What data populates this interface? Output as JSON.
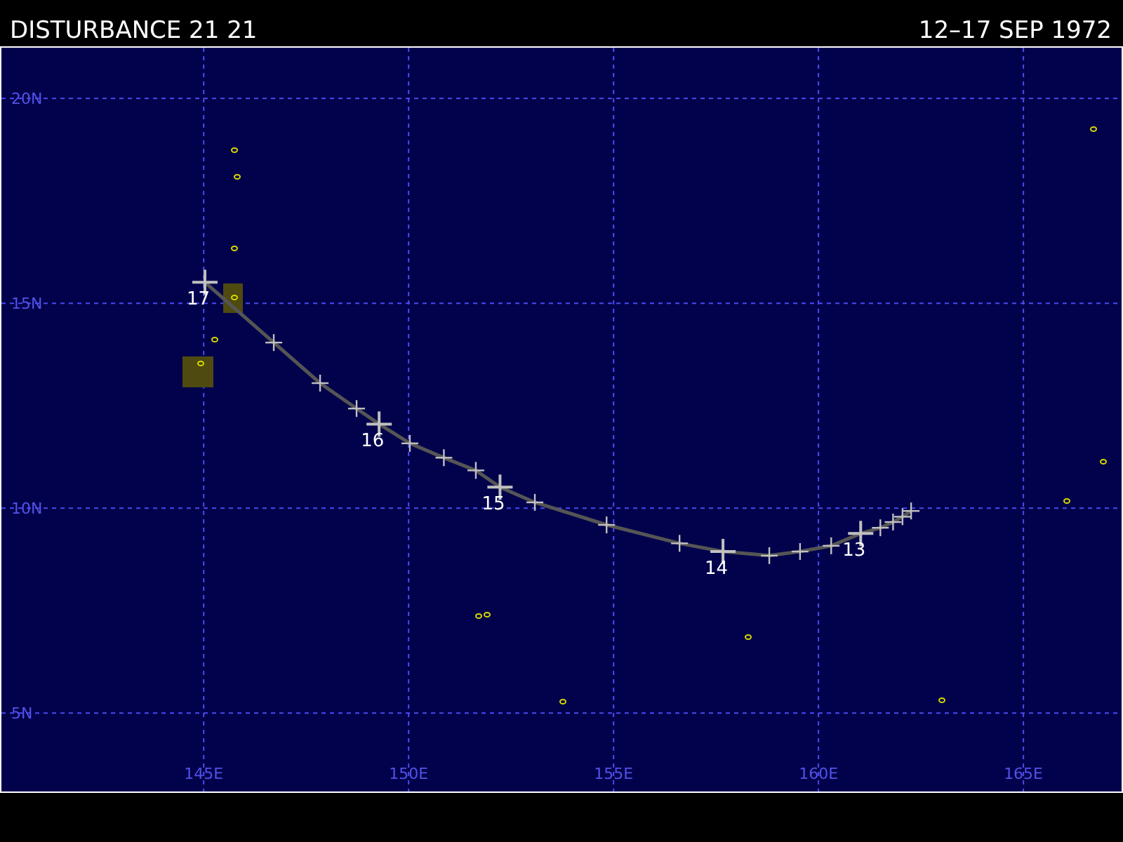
{
  "header": {
    "title": "DISTURBANCE 21 21",
    "date_range": "12–17 SEP 1972"
  },
  "map": {
    "chart_data": {
      "type": "line",
      "x": [
        145.03,
        146.71,
        147.84,
        148.73,
        149.28,
        150.03,
        150.86,
        151.64,
        152.23,
        153.08,
        154.83,
        156.61,
        157.67,
        158.8,
        159.55,
        160.31,
        161.03,
        161.51,
        161.82,
        162.05,
        162.26
      ],
      "grid": true,
      "series": [
        {
          "color": "#555555",
          "marker": "cross",
          "values": [
            15.51,
            14.04,
            13.05,
            12.43,
            12.05,
            11.58,
            11.23,
            10.92,
            10.51,
            10.14,
            9.59,
            9.14,
            8.94,
            8.84,
            8.94,
            9.08,
            9.38,
            9.52,
            9.66,
            9.79,
            9.93
          ]
        }
      ],
      "xlim": [
        140.03,
        167.43
      ],
      "ylim": [
        3.05,
        21.27
      ],
      "xticks": [
        {
          "value": 145,
          "label": "145E"
        },
        {
          "value": 150,
          "label": "150E"
        },
        {
          "value": 155,
          "label": "155E"
        },
        {
          "value": 160,
          "label": "160E"
        },
        {
          "value": 165,
          "label": "165E"
        }
      ],
      "yticks": [
        {
          "value": 5,
          "label": "5N"
        },
        {
          "value": 10,
          "label": "10N"
        },
        {
          "value": 15,
          "label": "15N"
        },
        {
          "value": 20,
          "label": "20N"
        }
      ],
      "annotations": [
        {
          "x": 145.03,
          "y": 15.51,
          "text": "17"
        },
        {
          "x": 149.28,
          "y": 12.05,
          "text": "16"
        },
        {
          "x": 152.23,
          "y": 10.51,
          "text": "15"
        },
        {
          "x": 157.67,
          "y": 8.94,
          "text": "14"
        },
        {
          "x": 161.03,
          "y": 9.38,
          "text": "13"
        }
      ]
    }
  }
}
